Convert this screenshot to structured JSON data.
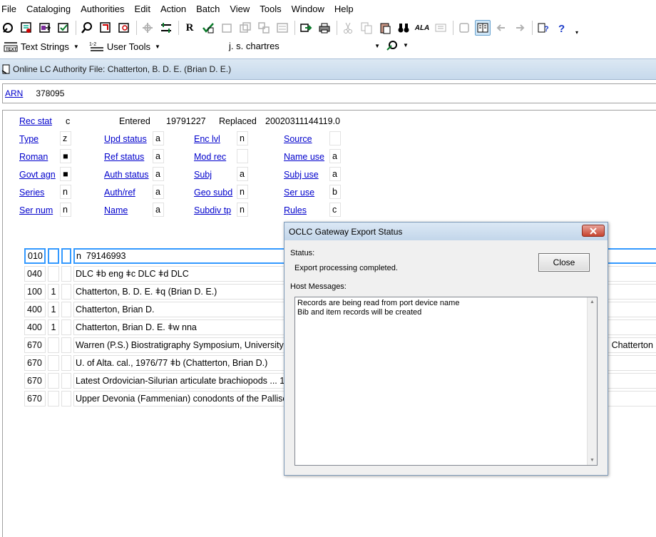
{
  "menubar": {
    "items": [
      "File",
      "Cataloging",
      "Authorities",
      "Edit",
      "Action",
      "Batch",
      "View",
      "Tools",
      "Window",
      "Help"
    ]
  },
  "toolbar1": {
    "icons": [
      "connexion-logon-icon",
      "online-save-icon",
      "export-icon",
      "validate-icon",
      "search-icon",
      "authority-search-icon",
      "browse-icon",
      "queue-icon",
      "workflow-icon",
      "reformat-icon",
      "control-headings-icon",
      "insert-from-cited-icon",
      "copy-record-icon",
      "derive-icon",
      "save-local-icon",
      "action-icon",
      "print-icon",
      "cut-icon",
      "copy-icon",
      "paste-icon",
      "binoculars-icon",
      "ala-icon",
      "diacritics-icon",
      "book-icon",
      "card-icon",
      "back-icon",
      "forward-icon",
      "help-topics-icon",
      "whats-this-icon",
      "more-icon"
    ],
    "r_label": "R",
    "ala_label": "ALA"
  },
  "toolbar2": {
    "text_strings_label": "Text Strings",
    "user_tools_label": "User Tools",
    "user_select_value": "j. s. chartres"
  },
  "doc": {
    "title": "Online LC Authority File: Chatterton, B. D. E. (Brian D. E.)",
    "arn_label": "ARN",
    "arn_value": "378095"
  },
  "fixed": {
    "rec_stat_label": "Rec stat",
    "rec_stat": "c",
    "entered_label": "Entered",
    "entered": "19791227",
    "replaced_label": "Replaced",
    "replaced": "20020311144119.0",
    "rows": [
      [
        {
          "label": "Type",
          "value": "z"
        },
        {
          "label": "Upd status",
          "value": "a"
        },
        {
          "label": "Enc lvl",
          "value": "n"
        },
        {
          "label": "Source",
          "value": ""
        }
      ],
      [
        {
          "label": "Roman",
          "value": "■"
        },
        {
          "label": "Ref status",
          "value": "a"
        },
        {
          "label": "Mod rec",
          "value": ""
        },
        {
          "label": "Name use",
          "value": "a"
        }
      ],
      [
        {
          "label": "Govt agn",
          "value": "■"
        },
        {
          "label": "Auth status",
          "value": "a"
        },
        {
          "label": "Subj",
          "value": "a"
        },
        {
          "label": "Subj use",
          "value": "a"
        }
      ],
      [
        {
          "label": "Series",
          "value": "n"
        },
        {
          "label": "Auth/ref",
          "value": "a"
        },
        {
          "label": "Geo subd",
          "value": "n"
        },
        {
          "label": "Ser use",
          "value": "b"
        }
      ],
      [
        {
          "label": "Ser num",
          "value": "n"
        },
        {
          "label": "Name",
          "value": "a"
        },
        {
          "label": "Subdiv tp",
          "value": "n"
        },
        {
          "label": "Rules",
          "value": "c"
        }
      ]
    ]
  },
  "fields": [
    {
      "tag": "010",
      "ind1": "",
      "ind2": "",
      "data": "n  79146993"
    },
    {
      "tag": "040",
      "ind1": "",
      "ind2": "",
      "data": "DLC ǂb eng ǂc DLC ǂd DLC"
    },
    {
      "tag": "100",
      "ind1": "1",
      "ind2": "",
      "data": "Chatterton, B. D. E. ǂq (Brian D. E.)"
    },
    {
      "tag": "400",
      "ind1": "1",
      "ind2": "",
      "data": "Chatterton, Brian D."
    },
    {
      "tag": "400",
      "ind1": "1",
      "ind2": "",
      "data": "Chatterton, Brian D. E. ǂw nna"
    },
    {
      "tag": "670",
      "ind1": "",
      "ind2": "",
      "data": "Warren (P.S.) Biostratigraphy Symposium, University o                                                                                                                            .E. Chatterton"
    },
    {
      "tag": "670",
      "ind1": "",
      "ind2": "",
      "data": "U. of Alta. cal., 1976/77 ǂb (Chatterton, Brian D.)"
    },
    {
      "tag": "670",
      "ind1": "",
      "ind2": "",
      "data": "Latest Ordovician-Silurian articulate brachiopods ... 19"
    },
    {
      "tag": "670",
      "ind1": "",
      "ind2": "",
      "data": "Upper Devonia (Fammenian) conodonts of the Pallise"
    }
  ],
  "dialog": {
    "title": "OCLC Gateway Export Status",
    "status_label": "Status:",
    "status_text": "Export processing completed.",
    "close_label": "Close",
    "host_messages_label": "Host Messages:",
    "messages": [
      "Records are being read from port device name",
      "Bib and item records will be created"
    ]
  }
}
